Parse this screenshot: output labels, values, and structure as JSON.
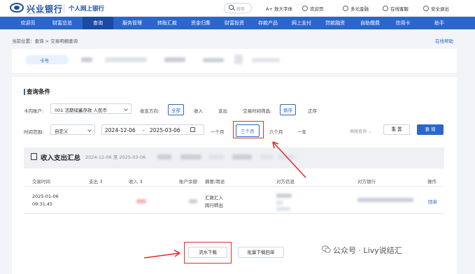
{
  "header": {
    "brand": "兴业银行",
    "brand_sub": "INDUSTRIAL BANK CO.,LTD.",
    "tagline": "个人网上银行",
    "search_placeholder": "搜索",
    "links": [
      {
        "name": "font-size",
        "label": "A+ 放大字体"
      },
      {
        "name": "home",
        "label": "欢迎页"
      },
      {
        "name": "finance",
        "label": "多元金融"
      },
      {
        "name": "service",
        "label": "在线客服"
      },
      {
        "name": "logout",
        "label": "安全退出"
      }
    ]
  },
  "nav": {
    "items": [
      "欢迎页",
      "财富总览",
      "查询",
      "服务管理",
      "转账汇款",
      "资金归集",
      "财富投资",
      "存款产品",
      "网上支付",
      "贷款融资",
      "自助缴费",
      "信用卡",
      "助手"
    ],
    "active_index": 2
  },
  "breadcrumb": "当前位置：查询 > 交易明细查询",
  "help_link": "在线帮助",
  "account_tab": "卡号",
  "query": {
    "section_title": "查询条件",
    "account_label": "卡内账户:",
    "account_value": "001 活期储蓄存款 人民币",
    "direction_label": "收支方向:",
    "direction_options": [
      "全部",
      "收入",
      "支出"
    ],
    "direction_selected": "全部",
    "time_filter_label": "交易时间筛选:",
    "time_filter_options": [
      "倒序",
      "正序"
    ],
    "time_filter_selected": "倒序",
    "range_label": "时间范围:",
    "range_value": "自定义",
    "date_start": "2024-12-06",
    "date_sep": "-",
    "date_end": "2025-03-06",
    "period_options": [
      "一个月",
      "三个月",
      "六个月",
      "一年"
    ],
    "period_selected": "三个月",
    "advanced_label": "高级查询",
    "reset_label": "重 置",
    "search_label": "查 询"
  },
  "summary": {
    "title": "收入支出汇总",
    "date_range": "2024-12-06 至 2025-03-06"
  },
  "table": {
    "headers": [
      "交易时间",
      "支出",
      "收入",
      "账户余额",
      "摘要/用途",
      "对方信息",
      "对方银行",
      "操作"
    ],
    "rows": [
      {
        "date": "2025-01-06",
        "time": "09:31:45",
        "memo1": "汇款汇入",
        "memo2": "跨行转出",
        "action": "回单"
      }
    ]
  },
  "actions": {
    "export_label": "流水下载",
    "batch_label": "批量下载回单"
  },
  "watermark": "公众号 · Livy说结汇",
  "colors": {
    "primary": "#2a66cc",
    "brand": "#1a4f9c",
    "highlight": "#e0302a"
  }
}
